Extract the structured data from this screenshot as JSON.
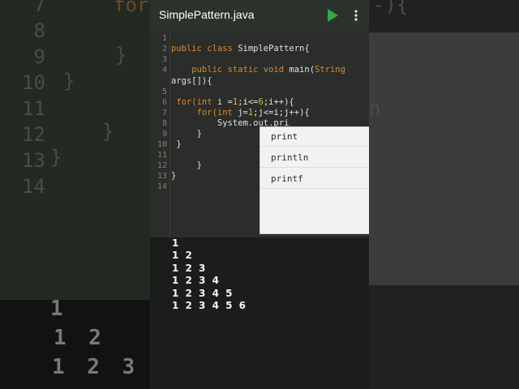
{
  "app": {
    "title": "SimplePattern.java",
    "run_icon": "play-icon",
    "menu_icon": "more-vert-icon",
    "accent_color": "#2fae3e"
  },
  "editor": {
    "line_numbers": [
      "1",
      "2",
      "3",
      "4",
      "5",
      "6",
      "7",
      "8",
      "9",
      "10",
      "11",
      "12",
      "13",
      "14"
    ],
    "code": {
      "l2a": "public class ",
      "l2b": "SimplePattern{",
      "l4a": "    public static void ",
      "l4b": "main(",
      "l4c": "String",
      "l4d": "args[]){",
      "l6a": " for(",
      "l6b": "int",
      "l6c": " i =",
      "l6d": "1",
      "l6e": ";i<=",
      "l6f": "6",
      "l6g": ";i++){",
      "l7a": "     for(",
      "l7b": "int",
      "l7c": " j=",
      "l7d": "1",
      "l7e": ";j<=i;j++){",
      "l8": "         System.out.pri",
      "l9": "     }",
      "l10": " }",
      "l12": "     }",
      "l13": "}"
    }
  },
  "autocomplete": {
    "items": [
      "print",
      "println",
      "printf"
    ]
  },
  "console": {
    "output": [
      "1",
      "1 2",
      "1 2 3",
      "1 2 3 4",
      "1 2 3 4 5",
      "1 2 3 4 5 6"
    ]
  },
  "background": {
    "gutter": [
      "7",
      "8",
      "9",
      "10",
      "11",
      "12",
      "13",
      "14"
    ],
    "code_top": "for",
    "code_top_right": "-){",
    "brace_9": "}",
    "brace_10": "}",
    "brace_12": "}",
    "brace_13": "}",
    "right_fragment": "n",
    "output": [
      "1",
      "1 2",
      "1 2 3"
    ]
  }
}
